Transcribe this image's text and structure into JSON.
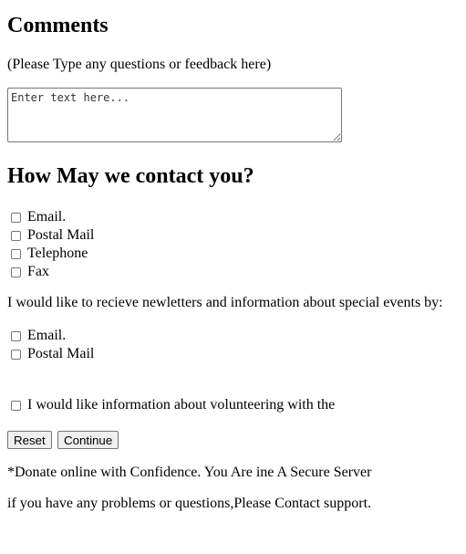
{
  "comments": {
    "title": "Comments",
    "hint": "(Please Type any questions or feedback here)",
    "textarea_placeholder": "Enter text here..."
  },
  "contact": {
    "title": "How May we contact you?",
    "options": [
      "Email.",
      "Postal Mail",
      "Telephone",
      "Fax"
    ]
  },
  "newsletter": {
    "prompt": "I would like to recieve newletters and information about special events by:",
    "options": [
      "Email.",
      "Postal Mail"
    ]
  },
  "volunteer": {
    "label": "I would like information about volunteering with the"
  },
  "buttons": {
    "reset": "Reset",
    "continue": "Continue"
  },
  "footer": {
    "donate_note": "*Donate online with Confidence. You Are ine A Secure Server",
    "support_note": "if you have any problems or questions,Please Contact support."
  }
}
